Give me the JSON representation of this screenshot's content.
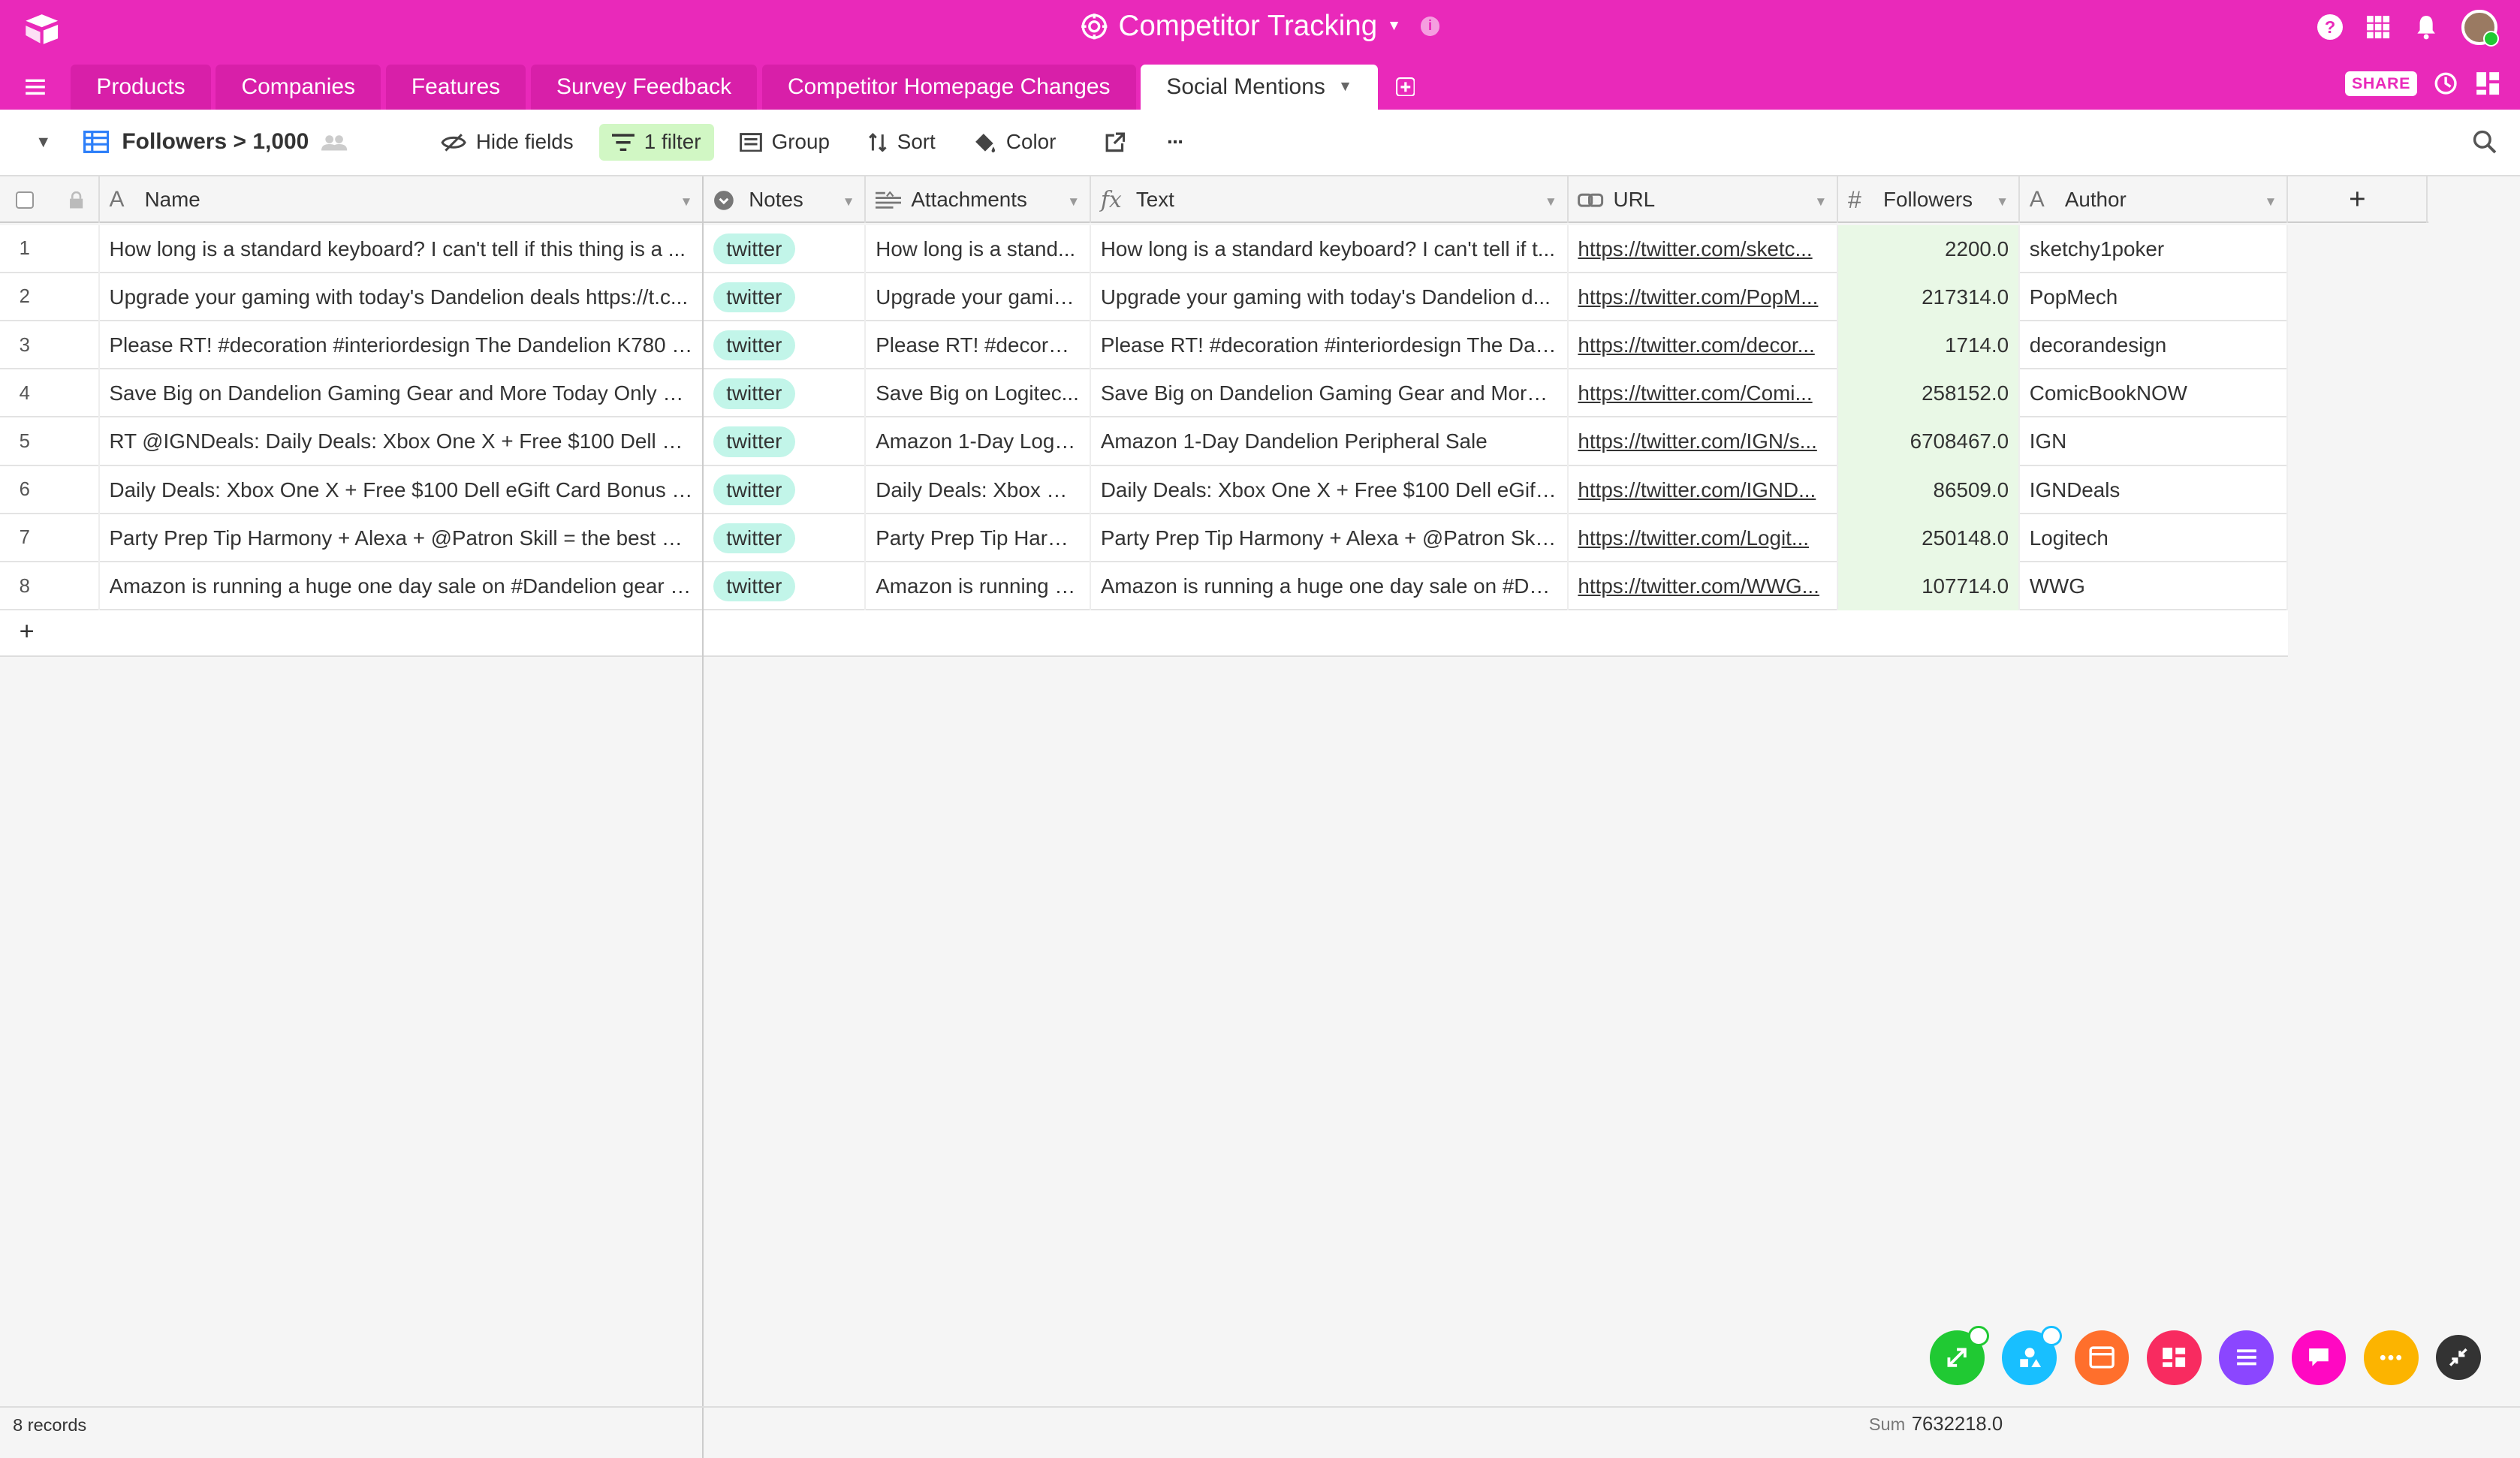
{
  "base": {
    "title": "Competitor Tracking"
  },
  "tabs": [
    {
      "label": "Products"
    },
    {
      "label": "Companies"
    },
    {
      "label": "Features"
    },
    {
      "label": "Survey Feedback"
    },
    {
      "label": "Competitor Homepage Changes"
    },
    {
      "label": "Social Mentions",
      "active": true
    }
  ],
  "share_label": "SHARE",
  "toolbar": {
    "view_name": "Followers > 1,000",
    "hide_fields": "Hide fields",
    "filter": "1 filter",
    "group": "Group",
    "sort": "Sort",
    "color": "Color",
    "more": "···"
  },
  "columns": {
    "name": "Name",
    "notes": "Notes",
    "attachments": "Attachments",
    "text": "Text",
    "url": "URL",
    "followers": "Followers",
    "author": "Author"
  },
  "rows": [
    {
      "num": "1",
      "name": "How long is a standard keyboard? I can't tell if this thing is a ...",
      "notes": "twitter",
      "att": "How long is a stand...",
      "text": "How long is a standard keyboard? I can't tell if t...",
      "url": "https://twitter.com/sketc...",
      "followers": "2200.0",
      "author": "sketchy1poker"
    },
    {
      "num": "2",
      "name": "Upgrade your gaming with today's Dandelion deals https://t.c...",
      "notes": "twitter",
      "att": "Upgrade your gamin...",
      "text": "Upgrade your gaming with today's Dandelion d...",
      "url": "https://twitter.com/PopM...",
      "followers": "217314.0",
      "author": "PopMech"
    },
    {
      "num": "3",
      "name": "Please RT! #decoration #interiordesign The Dandelion K780 K...",
      "notes": "twitter",
      "att": "Please RT! #decorat...",
      "text": "Please RT! #decoration #interiordesign The Dan...",
      "url": "https://twitter.com/decor...",
      "followers": "1714.0",
      "author": "decorandesign"
    },
    {
      "num": "4",
      "name": "Save Big on Dandelion Gaming Gear and More Today Only htt...",
      "notes": "twitter",
      "att": "Save Big on Logitec...",
      "text": "Save Big on Dandelion Gaming Gear and More T...",
      "url": "https://twitter.com/Comi...",
      "followers": "258152.0",
      "author": "ComicBookNOW"
    },
    {
      "num": "5",
      "name": "RT @IGNDeals: Daily Deals: Xbox One X + Free $100 Dell eGif...",
      "notes": "twitter",
      "att": "Amazon 1-Day Logit...",
      "text": "Amazon 1-Day Dandelion Peripheral Sale",
      "url": "https://twitter.com/IGN/s...",
      "followers": "6708467.0",
      "author": "IGN"
    },
    {
      "num": "6",
      "name": "Daily Deals: Xbox One X + Free $100 Dell eGift Card Bonus $1...",
      "notes": "twitter",
      "att": "Daily Deals: Xbox O...",
      "text": "Daily Deals: Xbox One X + Free $100 Dell eGift ...",
      "url": "https://twitter.com/IGND...",
      "followers": "86509.0",
      "author": "IGNDeals"
    },
    {
      "num": "7",
      "name": "Party Prep Tip Harmony + Alexa + @Patron Skill = the best w...",
      "notes": "twitter",
      "att": "Party Prep Tip Harm...",
      "text": "Party Prep Tip Harmony + Alexa + @Patron Skill...",
      "url": "https://twitter.com/Logit...",
      "followers": "250148.0",
      "author": "Logitech"
    },
    {
      "num": "8",
      "name": "Amazon is running a huge one day sale on #Dandelion gear fo...",
      "notes": "twitter",
      "att": "Amazon is running a...",
      "text": "Amazon is running a huge one day sale on #Dan...",
      "url": "https://twitter.com/WWG...",
      "followers": "107714.0",
      "author": "WWG"
    }
  ],
  "footer": {
    "records": "8 records",
    "sum_label": "Sum",
    "sum_value": "7632218.0"
  },
  "colors": {
    "brand": "#e929ba",
    "tab_inactive": "#d81fa9",
    "filter_bg": "#d1f7c4",
    "pill_bg": "#c2f5e9",
    "followers_bg": "#e9f8e6"
  },
  "app_icons": [
    {
      "name": "expand-arrows-icon",
      "color": "#20c933"
    },
    {
      "name": "blocks-icon",
      "color": "#18bfff"
    },
    {
      "name": "image-icon",
      "color": "#ff6f2c"
    },
    {
      "name": "layout-icon",
      "color": "#f82b60"
    },
    {
      "name": "list-icon",
      "color": "#8b46ff"
    },
    {
      "name": "chat-icon",
      "color": "#ff08c2"
    },
    {
      "name": "more-icon",
      "color": "#fcb400"
    },
    {
      "name": "collapse-icon",
      "color": "#333333"
    }
  ]
}
